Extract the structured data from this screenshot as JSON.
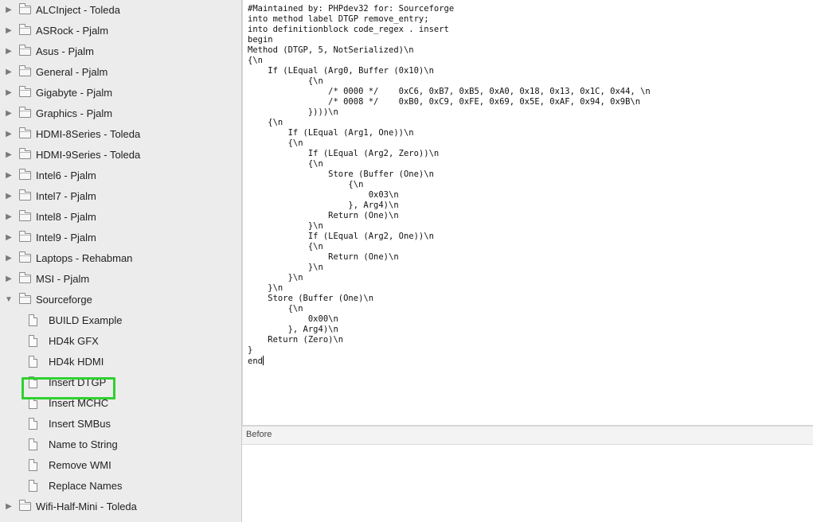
{
  "sidebar": {
    "items": [
      {
        "type": "folder",
        "label": "ALCInject - Toleda",
        "expanded": false
      },
      {
        "type": "folder",
        "label": "ASRock - Pjalm",
        "expanded": false
      },
      {
        "type": "folder",
        "label": "Asus - Pjalm",
        "expanded": false
      },
      {
        "type": "folder",
        "label": "General - Pjalm",
        "expanded": false
      },
      {
        "type": "folder",
        "label": "Gigabyte - Pjalm",
        "expanded": false
      },
      {
        "type": "folder",
        "label": "Graphics - Pjalm",
        "expanded": false
      },
      {
        "type": "folder",
        "label": "HDMI-8Series - Toleda",
        "expanded": false
      },
      {
        "type": "folder",
        "label": "HDMI-9Series - Toleda",
        "expanded": false
      },
      {
        "type": "folder",
        "label": "Intel6 - Pjalm",
        "expanded": false
      },
      {
        "type": "folder",
        "label": "Intel7 - Pjalm",
        "expanded": false
      },
      {
        "type": "folder",
        "label": "Intel8 - Pjalm",
        "expanded": false
      },
      {
        "type": "folder",
        "label": "Intel9 - Pjalm",
        "expanded": false
      },
      {
        "type": "folder",
        "label": "Laptops - Rehabman",
        "expanded": false
      },
      {
        "type": "folder",
        "label": "MSI - Pjalm",
        "expanded": false
      },
      {
        "type": "folder",
        "label": "Sourceforge",
        "expanded": true
      },
      {
        "type": "file",
        "label": "BUILD Example"
      },
      {
        "type": "file",
        "label": "HD4k GFX"
      },
      {
        "type": "file",
        "label": "HD4k HDMI"
      },
      {
        "type": "file",
        "label": "Insert DTGP",
        "selected": true
      },
      {
        "type": "file",
        "label": "Insert MCHC"
      },
      {
        "type": "file",
        "label": "Insert SMBus"
      },
      {
        "type": "file",
        "label": "Name to String"
      },
      {
        "type": "file",
        "label": "Remove WMI"
      },
      {
        "type": "file",
        "label": "Replace Names"
      },
      {
        "type": "folder",
        "label": "Wifi-Half-Mini - Toleda",
        "expanded": false
      }
    ],
    "highlight_color": "#2fd12f"
  },
  "editor": {
    "lines": [
      "#Maintained by: PHPdev32 for: Sourceforge",
      "into method label DTGP remove_entry;",
      "into definitionblock code_regex . insert",
      "begin",
      "Method (DTGP, 5, NotSerialized)\\n",
      "{\\n",
      "    If (LEqual (Arg0, Buffer (0x10)\\n",
      "            {\\n",
      "                /* 0000 */    0xC6, 0xB7, 0xB5, 0xA0, 0x18, 0x13, 0x1C, 0x44, \\n",
      "                /* 0008 */    0xB0, 0xC9, 0xFE, 0x69, 0x5E, 0xAF, 0x94, 0x9B\\n",
      "            })))\\n",
      "    {\\n",
      "        If (LEqual (Arg1, One))\\n",
      "        {\\n",
      "            If (LEqual (Arg2, Zero))\\n",
      "            {\\n",
      "                Store (Buffer (One)\\n",
      "                    {\\n",
      "                        0x03\\n",
      "                    }, Arg4)\\n",
      "                Return (One)\\n",
      "            }\\n",
      "            If (LEqual (Arg2, One))\\n",
      "            {\\n",
      "                Return (One)\\n",
      "            }\\n",
      "        }\\n",
      "    }\\n",
      "    Store (Buffer (One)\\n",
      "        {\\n",
      "            0x00\\n",
      "        }, Arg4)\\n",
      "    Return (Zero)\\n",
      "}",
      "end"
    ]
  },
  "before": {
    "label": "Before"
  }
}
